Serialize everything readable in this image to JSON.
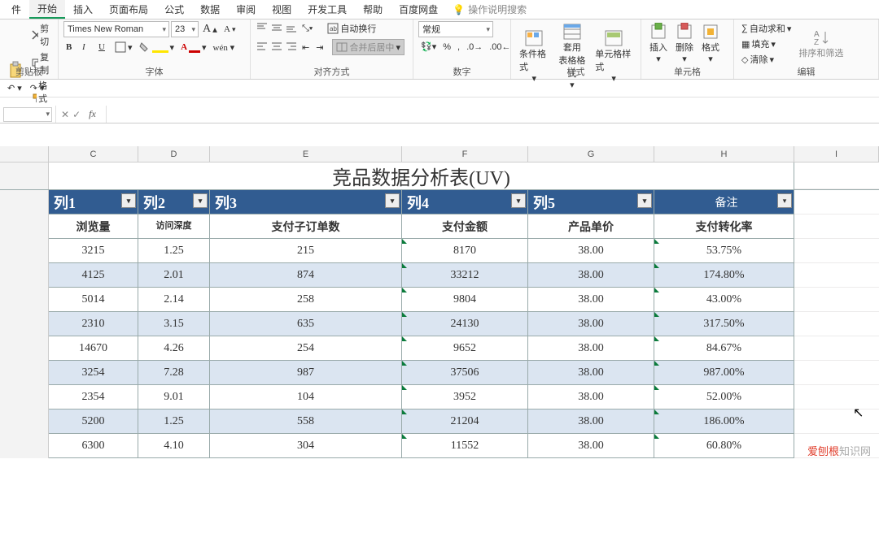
{
  "menu": {
    "items": [
      "件",
      "开始",
      "插入",
      "页面布局",
      "公式",
      "数据",
      "审阅",
      "视图",
      "开发工具",
      "帮助",
      "百度网盘"
    ],
    "active": 1,
    "hint": "操作说明搜索"
  },
  "ribbon": {
    "clipboard": {
      "cut": "剪切",
      "copy": "复制",
      "painter": "格式刷",
      "title": "剪贴板"
    },
    "font": {
      "family": "Times New Roman",
      "size": "23",
      "grow": "A",
      "shrink": "A",
      "bold": "B",
      "italic": "I",
      "underline": "U",
      "title": "字体"
    },
    "align": {
      "wrap": "自动换行",
      "merge": "合并后居中",
      "title": "对齐方式"
    },
    "number": {
      "format": "常规",
      "title": "数字",
      "percent": "%"
    },
    "style": {
      "cond": "条件格式",
      "tbl": "套用\n表格格式",
      "cell": "单元格样式",
      "title": "样式"
    },
    "cells": {
      "insert": "插入",
      "delete": "删除",
      "format": "格式",
      "title": "单元格"
    },
    "edit": {
      "sum": "自动求和",
      "fill": "填充",
      "clear": "清除",
      "sort": "排序和筛选",
      "title": "编辑"
    }
  },
  "formula_bar": {
    "fx": "fx"
  },
  "columns": {
    "C": "C",
    "D": "D",
    "E": "E",
    "F": "F",
    "G": "G",
    "H": "H",
    "I": "I"
  },
  "title": "竞品数据分析表(UV)",
  "filter_headers": [
    "列1",
    "列2",
    "列3",
    "列4",
    "列5",
    "备注"
  ],
  "sub_headers": [
    "浏览量",
    "访问深度",
    "支付子订单数",
    "支付金额",
    "产品单价",
    "支付转化率"
  ],
  "rows": [
    {
      "c": "3215",
      "d": "1.25",
      "e": "215",
      "f": "8170",
      "g": "38.00",
      "h": "53.75%"
    },
    {
      "c": "4125",
      "d": "2.01",
      "e": "874",
      "f": "33212",
      "g": "38.00",
      "h": "174.80%"
    },
    {
      "c": "5014",
      "d": "2.14",
      "e": "258",
      "f": "9804",
      "g": "38.00",
      "h": "43.00%"
    },
    {
      "c": "2310",
      "d": "3.15",
      "e": "635",
      "f": "24130",
      "g": "38.00",
      "h": "317.50%"
    },
    {
      "c": "14670",
      "d": "4.26",
      "e": "254",
      "f": "9652",
      "g": "38.00",
      "h": "84.67%"
    },
    {
      "c": "3254",
      "d": "7.28",
      "e": "987",
      "f": "37506",
      "g": "38.00",
      "h": "987.00%"
    },
    {
      "c": "2354",
      "d": "9.01",
      "e": "104",
      "f": "3952",
      "g": "38.00",
      "h": "52.00%"
    },
    {
      "c": "5200",
      "d": "1.25",
      "e": "558",
      "f": "21204",
      "g": "38.00",
      "h": "186.00%"
    },
    {
      "c": "6300",
      "d": "4.10",
      "e": "304",
      "f": "11552",
      "g": "38.00",
      "h": "60.80%"
    }
  ],
  "watermark": {
    "red": "爱刨根",
    "gray": "知识网"
  }
}
